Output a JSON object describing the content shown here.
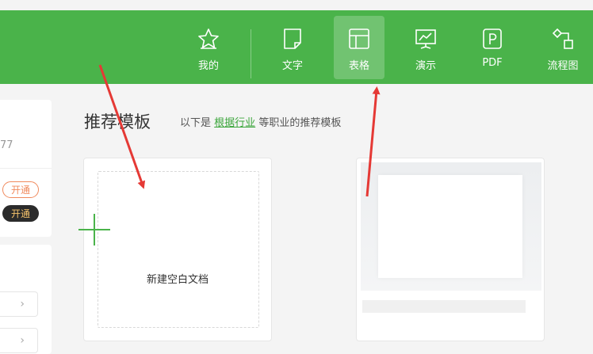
{
  "nav": {
    "items": [
      {
        "label": "我的",
        "icon": "star-icon"
      },
      {
        "label": "文字",
        "icon": "document-icon"
      },
      {
        "label": "表格",
        "icon": "table-icon",
        "active": true
      },
      {
        "label": "演示",
        "icon": "presentation-icon"
      },
      {
        "label": "PDF",
        "icon": "pdf-icon"
      },
      {
        "label": "流程图",
        "icon": "flowchart-icon"
      }
    ]
  },
  "sidebar": {
    "truncated_text": "77",
    "open_label_1": "开通",
    "open_label_2": "开通"
  },
  "main": {
    "title": "推荐模板",
    "subtitle_prefix": "以下是",
    "subtitle_link": "根据行业",
    "subtitle_suffix": "等职业的推荐模板",
    "new_blank_label": "新建空白文档"
  },
  "colors": {
    "brand_green": "#4ab34a",
    "arrow_red": "#e53935"
  }
}
